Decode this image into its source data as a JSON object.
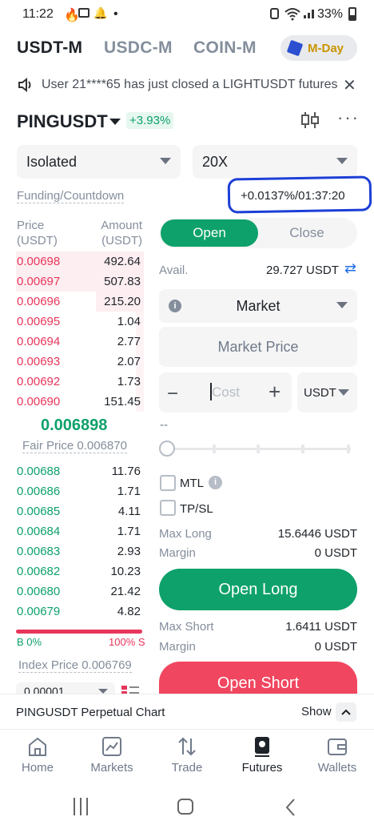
{
  "status": {
    "time": "11:22",
    "battery": "33%"
  },
  "tabs": {
    "usdt": "USDT-M",
    "usdc": "USDC-M",
    "coin": "COIN-M",
    "mday": "M-Day"
  },
  "notice": {
    "text": "User 21****65 has just closed a LIGHTUSDT futures"
  },
  "pair": {
    "symbol": "PINGUSDT",
    "change": "+3.93%"
  },
  "margin_mode": "Isolated",
  "leverage": "20X",
  "funding": {
    "label": "Funding/Countdown",
    "value": "+0.0137%/01:37:20"
  },
  "orderbook": {
    "price_header": "Price",
    "price_unit": "(USDT)",
    "amount_header": "Amount",
    "amount_unit": "(USDT)",
    "asks": [
      {
        "price": "0.00698",
        "amount": "492.64"
      },
      {
        "price": "0.00697",
        "amount": "507.83"
      },
      {
        "price": "0.00696",
        "amount": "215.20"
      },
      {
        "price": "0.00695",
        "amount": "1.04"
      },
      {
        "price": "0.00694",
        "amount": "2.77"
      },
      {
        "price": "0.00693",
        "amount": "2.07"
      },
      {
        "price": "0.00692",
        "amount": "1.73"
      },
      {
        "price": "0.00690",
        "amount": "151.45"
      }
    ],
    "last_price": "0.006898",
    "fair_price": "Fair Price 0.006870",
    "bids": [
      {
        "price": "0.00688",
        "amount": "11.76"
      },
      {
        "price": "0.00686",
        "amount": "1.71"
      },
      {
        "price": "0.00685",
        "amount": "4.11"
      },
      {
        "price": "0.00684",
        "amount": "1.71"
      },
      {
        "price": "0.00683",
        "amount": "2.93"
      },
      {
        "price": "0.00682",
        "amount": "10.23"
      },
      {
        "price": "0.00680",
        "amount": "21.42"
      },
      {
        "price": "0.00679",
        "amount": "4.82"
      }
    ],
    "buy_ratio": "B 0%",
    "sell_ratio": "100% S",
    "index_price": "Index Price 0.006769",
    "precision": "0.00001"
  },
  "order": {
    "open_tab": "Open",
    "close_tab": "Close",
    "avail_label": "Avail.",
    "avail_value": "29.727 USDT",
    "order_type": "Market",
    "market_price": "Market Price",
    "cost_placeholder": "Cost",
    "cost_unit": "USDT",
    "dash": "--",
    "mtl": "MTL",
    "tpsl": "TP/SL",
    "max_long_label": "Max Long",
    "max_long_value": "15.6446 USDT",
    "margin_label": "Margin",
    "margin_long_value": "0 USDT",
    "open_long": "Open Long",
    "max_short_label": "Max Short",
    "max_short_value": "1.6411 USDT",
    "margin_short_value": "0 USDT",
    "open_short": "Open Short"
  },
  "chart_bar": {
    "label": "PINGUSDT Perpetual Chart",
    "show": "Show"
  },
  "nav": {
    "home": "Home",
    "markets": "Markets",
    "trade": "Trade",
    "futures": "Futures",
    "wallets": "Wallets"
  },
  "colors": {
    "green": "#0ea16b",
    "red": "#e8355b",
    "brand_yellow": "#c99400",
    "annotation_blue": "#1d3fd6"
  }
}
